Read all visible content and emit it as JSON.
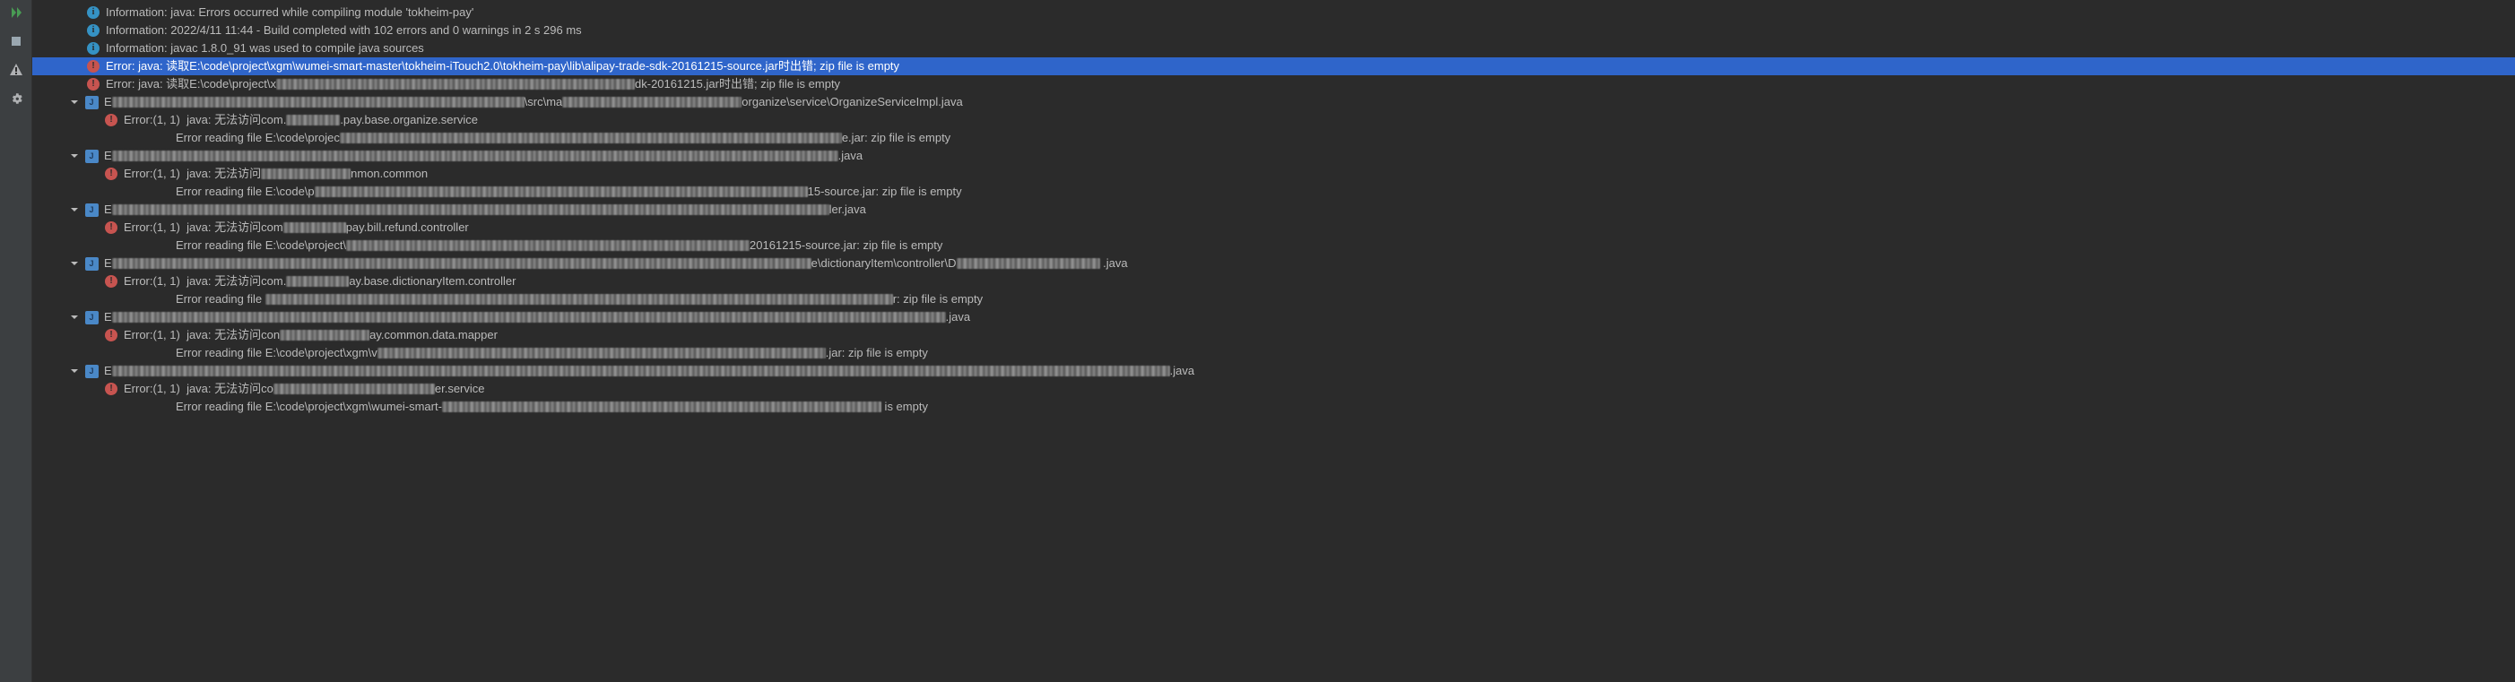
{
  "messages": {
    "info1": "Information: java: Errors occurred while compiling module 'tokheim-pay'",
    "info2": "Information: 2022/4/11 11:44 - Build completed with 102 errors and 0 warnings in 2 s 296 ms",
    "info3": "Information: javac 1.8.0_91 was used to compile java sources",
    "err1": "Error: java: 读取E:\\code\\project\\xgm\\wumei-smart-master\\tokheim-iTouch2.0\\tokheim-pay\\lib\\alipay-trade-sdk-20161215-source.jar时出错; zip file is empty",
    "err2_pre": "Error: java: 读取E:\\code\\project\\x",
    "err2_post": "dk-20161215.jar时出错; zip file is empty"
  },
  "groups": [
    {
      "file_pre": "E",
      "file_mid": "\\src\\ma",
      "file_post": "organize\\service\\OrganizeServiceImpl.java",
      "err_pre": "Error:(1, 1)  java: 无法访问com.",
      "err_post": ".pay.base.organize.service",
      "detail_pre": "Error reading file E:\\code\\projec",
      "detail_post": "e.jar: zip file is empty"
    },
    {
      "file_pre": "E",
      "file_mid": "",
      "file_post": ".java",
      "err_pre": "Error:(1, 1)  java: 无法访问",
      "err_post": "nmon.common",
      "detail_pre": "Error reading file E:\\code\\p",
      "detail_post": "15-source.jar: zip file is empty"
    },
    {
      "file_pre": "E",
      "file_mid": "",
      "file_post": "ler.java",
      "err_pre": "Error:(1, 1)  java: 无法访问com",
      "err_post": "pay.bill.refund.controller",
      "detail_pre": "Error reading file E:\\code\\project\\",
      "detail_post": "20161215-source.jar: zip file is empty"
    },
    {
      "file_pre": "E",
      "file_mid": "e\\dictionaryItem\\controller\\D",
      "file_post": " .java",
      "err_pre": "Error:(1, 1)  java: 无法访问com.",
      "err_post": "ay.base.dictionaryItem.controller",
      "detail_pre": "Error reading file ",
      "detail_post": "r: zip file is empty"
    },
    {
      "file_pre": "E",
      "file_mid": "",
      "file_post": ".java",
      "err_pre": "Error:(1, 1)  java: 无法访问con",
      "err_post": "ay.common.data.mapper",
      "detail_pre": "Error reading file E:\\code\\project\\xgm\\v",
      "detail_post": ".jar: zip file is empty"
    },
    {
      "file_pre": "E",
      "file_mid": "",
      "file_post": ".java",
      "err_pre": "Error:(1, 1)  java: 无法访问co",
      "err_post": "er.service",
      "detail_pre": "Error reading file E:\\code\\project\\xgm\\wumei-smart-",
      "detail_post": " is empty"
    }
  ]
}
